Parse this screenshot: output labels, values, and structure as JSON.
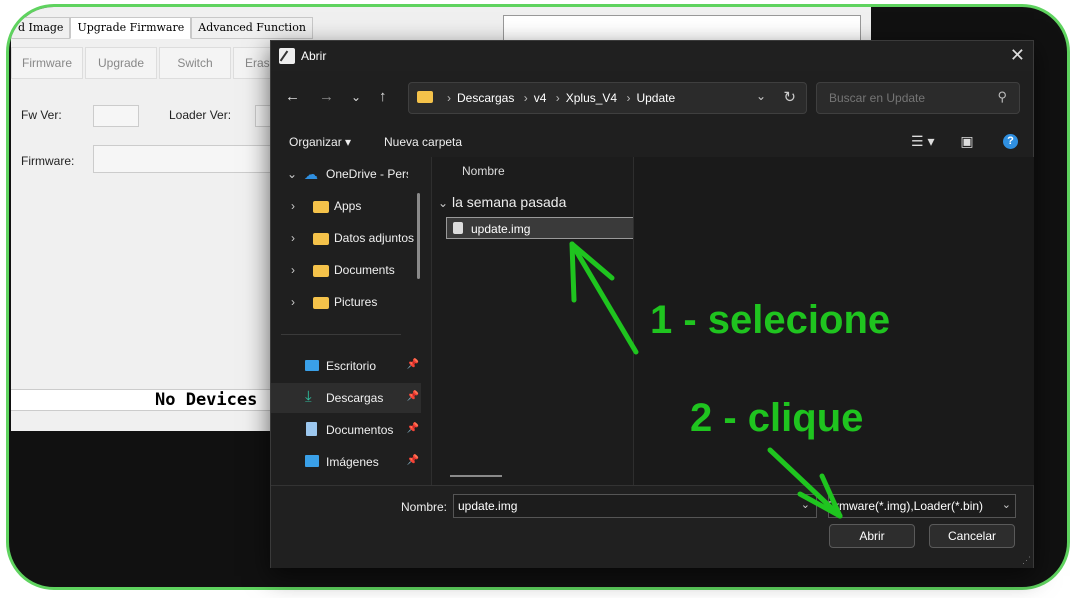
{
  "background_app": {
    "tabs": [
      "d Image",
      "Upgrade Firmware",
      "Advanced Function"
    ],
    "buttons": [
      "Firmware",
      "Upgrade",
      "Switch",
      "EraseFla"
    ],
    "fw_ver_label": "Fw Ver:",
    "loader_ver_label": "Loader Ver:",
    "firmware_label": "Firmware:",
    "status": "No Devices"
  },
  "dialog": {
    "title": "Abrir",
    "breadcrumbs": [
      "Descargas",
      "v4",
      "Xplus_V4",
      "Update"
    ],
    "search_placeholder": "Buscar en Update",
    "toolbar": {
      "organize": "Organizar ▾",
      "new_folder": "Nueva carpeta"
    },
    "sidebar": {
      "onedrive": "OneDrive - Pers",
      "folders": [
        "Apps",
        "Datos adjuntos",
        "Documents",
        "Pictures"
      ],
      "quick_access": [
        "Escritorio",
        "Descargas",
        "Documentos",
        "Imágenes"
      ]
    },
    "files": {
      "column_header": "Nombre",
      "group": "la semana pasada",
      "items": [
        "update.img"
      ]
    },
    "bottom": {
      "name_label": "Nombre:",
      "name_value": "update.img",
      "filetype_value": "Firmware(*.img),Loader(*.bin)",
      "open_button": "Abrir",
      "cancel_button": "Cancelar"
    }
  },
  "annotations": {
    "step1": "1 - selecione",
    "step2": "2 - clique",
    "color": "#1fc41f"
  }
}
